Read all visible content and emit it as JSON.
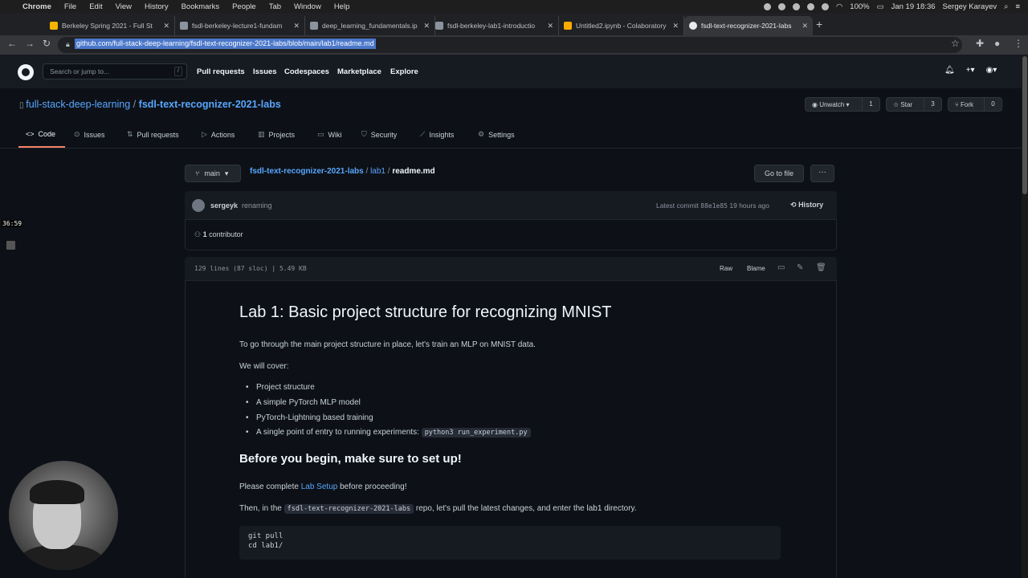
{
  "menubar": {
    "app": "Chrome",
    "items": [
      "File",
      "Edit",
      "View",
      "History",
      "Bookmarks",
      "People",
      "Tab",
      "Window",
      "Help"
    ],
    "battery": "100%",
    "datetime": "Jan 19  18:36",
    "user": "Sergey Karayev"
  },
  "tabs": [
    {
      "label": "Berkeley Spring 2021 - Full St"
    },
    {
      "label": "fsdl-berkeley-lecture1-fundam"
    },
    {
      "label": "deep_learning_fundamentals.ip"
    },
    {
      "label": "fsdl-berkeley-lab1-introductio"
    },
    {
      "label": "Untitled2.ipynb - Colaboratory"
    },
    {
      "label": "fsdl-text-recognizer-2021-labs"
    }
  ],
  "address": {
    "url": "github.com/full-stack-deep-learning/fsdl-text-recognizer-2021-labs/blob/main/lab1/readme.md"
  },
  "github_header": {
    "search_placeholder": "Search or jump to...",
    "search_key": "/",
    "nav": [
      "Pull requests",
      "Issues",
      "Codespaces",
      "Marketplace",
      "Explore"
    ]
  },
  "repo": {
    "owner": "full-stack-deep-learning",
    "separator": "/",
    "name": "fsdl-text-recognizer-2021-labs",
    "unwatch_label": "Unwatch",
    "watch_count": "1",
    "star_label": "Star",
    "star_count": "3",
    "fork_label": "Fork",
    "fork_count": "0",
    "tabs": [
      "Code",
      "Issues",
      "Pull requests",
      "Actions",
      "Projects",
      "Wiki",
      "Security",
      "Insights",
      "Settings"
    ]
  },
  "file_nav": {
    "branch": "main",
    "crumb_repo": "fsdl-text-recognizer-2021-labs",
    "crumb_sep1": " / ",
    "crumb_dir": "lab1",
    "crumb_sep2": " / ",
    "crumb_file": "readme.md",
    "goto_label": "Go to file",
    "more_label": "···"
  },
  "commit": {
    "user": "sergeyk",
    "message": "renaming",
    "latest_label": "Latest commit",
    "sha": "88e1e85",
    "age": "19 hours ago",
    "history_label": "History",
    "contributors": "1",
    "contributors_label": "contributor"
  },
  "file": {
    "info": "129 lines (87 sloc)  |  5.49 KB",
    "raw_label": "Raw",
    "blame_label": "Blame"
  },
  "readme": {
    "h1": "Lab 1: Basic project structure for recognizing MNIST",
    "intro": "To go through the main project structure in place, let's train an MLP on MNIST data.",
    "cover": "We will cover:",
    "bullets": [
      "Project structure",
      "A simple PyTorch MLP model",
      "PyTorch-Lightning based training",
      "A single point of entry to running experiments:"
    ],
    "bullet_code": "python3 run_experiment.py",
    "h2": "Before you begin, make sure to set up!",
    "setup_pre": "Please complete ",
    "setup_link": "Lab Setup",
    "setup_post": " before proceeding!",
    "then_pre": "Then, in the ",
    "then_code": "fsdl-text-recognizer-2021-labs",
    "then_post": " repo, let's pull the latest changes, and enter the lab1 directory.",
    "code_lines": "git pull\ncd lab1/"
  },
  "overlay": {
    "timer": "36:59"
  }
}
